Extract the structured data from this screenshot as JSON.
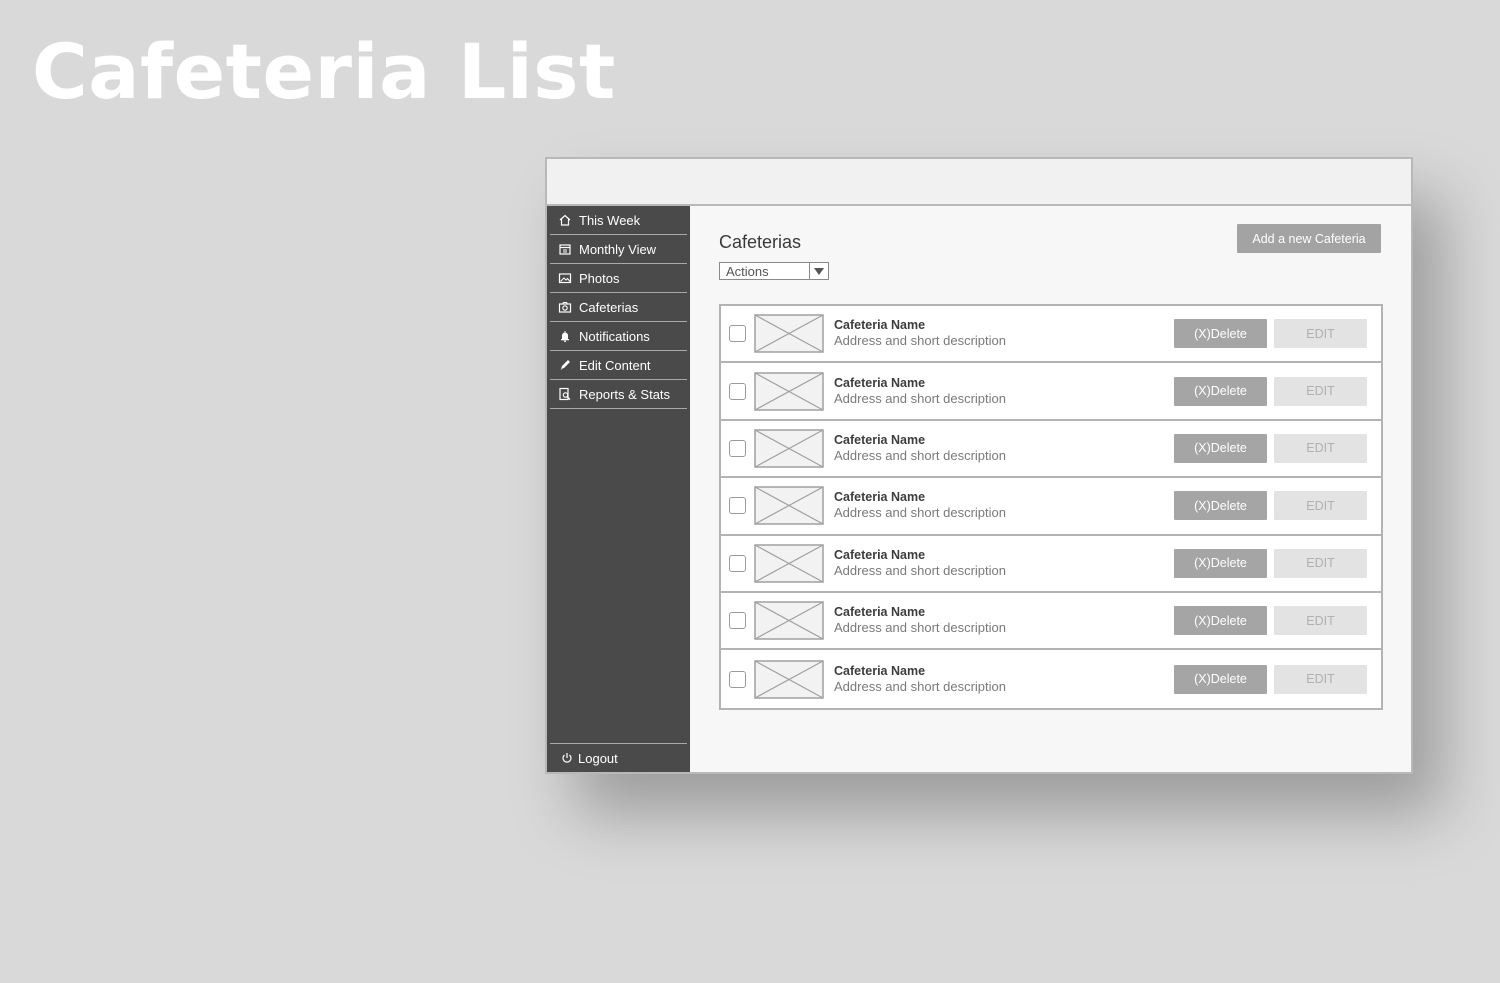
{
  "page": {
    "heading": "Cafeteria List"
  },
  "sidebar": {
    "items": [
      {
        "label": "This Week",
        "icon": "home-icon"
      },
      {
        "label": "Monthly View",
        "icon": "calendar-icon"
      },
      {
        "label": "Photos",
        "icon": "image-icon"
      },
      {
        "label": "Cafeterias",
        "icon": "camera-icon"
      },
      {
        "label": "Notifications",
        "icon": "bell-icon"
      },
      {
        "label": "Edit Content",
        "icon": "pencil-icon"
      },
      {
        "label": "Reports & Stats",
        "icon": "report-icon"
      }
    ],
    "logout": {
      "label": "Logout",
      "icon": "power-icon"
    }
  },
  "main": {
    "title": "Cafeterias",
    "add_button": "Add a new Cafeteria",
    "actions_select": {
      "selected": "Actions"
    },
    "rows": [
      {
        "name": "Cafeteria Name",
        "description": "Address and short description",
        "delete_label": "(X)Delete",
        "edit_label": "EDIT"
      },
      {
        "name": "Cafeteria Name",
        "description": "Address and short description",
        "delete_label": "(X)Delete",
        "edit_label": "EDIT"
      },
      {
        "name": "Cafeteria Name",
        "description": "Address and short description",
        "delete_label": "(X)Delete",
        "edit_label": "EDIT"
      },
      {
        "name": "Cafeteria Name",
        "description": "Address and short description",
        "delete_label": "(X)Delete",
        "edit_label": "EDIT"
      },
      {
        "name": "Cafeteria Name",
        "description": "Address and short description",
        "delete_label": "(X)Delete",
        "edit_label": "EDIT"
      },
      {
        "name": "Cafeteria Name",
        "description": "Address and short description",
        "delete_label": "(X)Delete",
        "edit_label": "EDIT"
      },
      {
        "name": "Cafeteria Name",
        "description": "Address and short description",
        "delete_label": "(X)Delete",
        "edit_label": "EDIT"
      }
    ]
  },
  "colors": {
    "background": "#d9d9d9",
    "sidebar": "#4a4a4a",
    "delete_button": "#a5a5a5",
    "edit_button": "#e3e3e3",
    "heading": "#ffffff"
  }
}
